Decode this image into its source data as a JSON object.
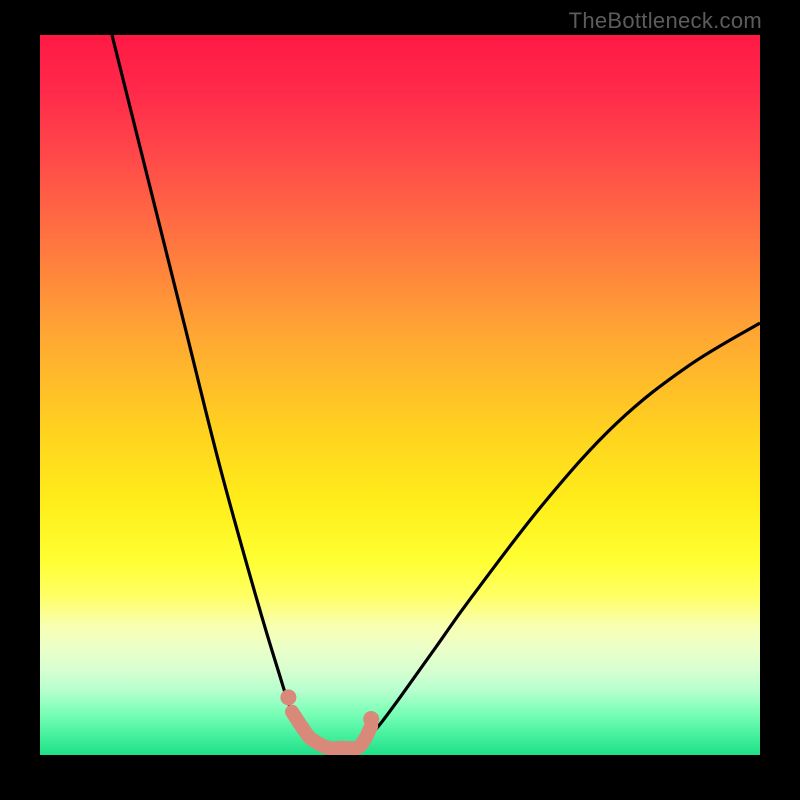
{
  "watermark": "TheBottleneck.com",
  "chart_data": {
    "type": "line",
    "title": "",
    "xlabel": "",
    "ylabel": "",
    "xlim": [
      0,
      100
    ],
    "ylim": [
      0,
      100
    ],
    "series": [
      {
        "name": "left-curve",
        "x": [
          10,
          15,
          20,
          25,
          30,
          33,
          35,
          37,
          38
        ],
        "values": [
          100,
          80,
          60,
          40,
          22,
          12,
          6,
          3,
          2
        ]
      },
      {
        "name": "right-curve",
        "x": [
          45,
          47,
          50,
          55,
          60,
          70,
          80,
          90,
          100
        ],
        "values": [
          2,
          4,
          8,
          15,
          22,
          35,
          46,
          54,
          60
        ]
      },
      {
        "name": "salmon-min-segment",
        "x": [
          35,
          37,
          38,
          40,
          42,
          44,
          45,
          46
        ],
        "values": [
          6,
          3,
          2,
          1,
          1,
          1,
          2,
          4
        ]
      },
      {
        "name": "salmon-dot-left",
        "x": [
          34.5
        ],
        "values": [
          8
        ]
      },
      {
        "name": "salmon-dot-right",
        "x": [
          46
        ],
        "values": [
          5
        ]
      }
    ]
  },
  "colors": {
    "curve": "#000000",
    "salmon": "#d98979"
  }
}
